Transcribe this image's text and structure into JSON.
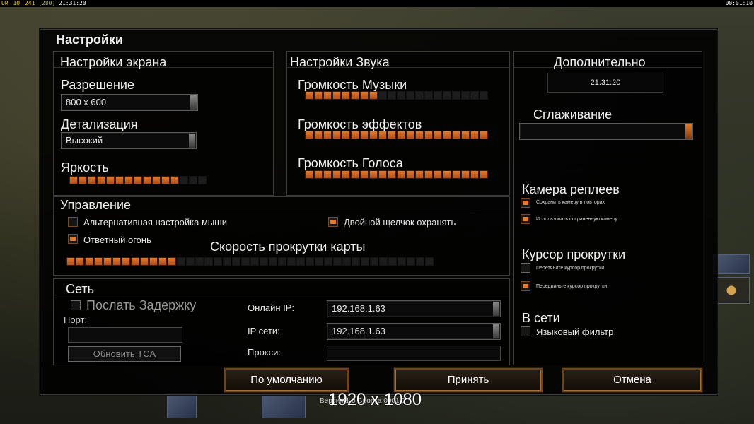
{
  "topbar": {
    "ur": "UR",
    "n1": "10",
    "n2": "241",
    "n3": "[280]",
    "time_left": "21:31:20",
    "time_right": "00:01:10"
  },
  "dialog": {
    "title": "Настройки"
  },
  "screen": {
    "header": "Настройки экрана",
    "resolution_label": "Разрешение",
    "resolution_value": "800 x 600",
    "detail_label": "Детализация",
    "detail_value": "Высокий",
    "brightness_label": "Яркость",
    "brightness_level": 12,
    "brightness_total": 15
  },
  "sound": {
    "header": "Настройки Звука",
    "music_label": "Громкость Музыки",
    "music_level": 8,
    "effects_label": "Громкость эффектов",
    "effects_level": 20,
    "voice_label": "Громкость Голоса",
    "voice_level": 20,
    "total": 20
  },
  "extra": {
    "header": "Дополнительно",
    "clock": "21:31:20",
    "antialias_label": "Сглаживание",
    "antialias_value": "",
    "replay_header": "Камера реплеев",
    "replay_opt1": "Сохранить камеру в повторах",
    "replay_opt1_checked": true,
    "replay_opt2": "Использовать сохраненную камеру",
    "replay_opt2_checked": true,
    "scroll_header": "Курсор прокрутки",
    "scroll_opt1": "Перетяните курсор прокрутки",
    "scroll_opt1_checked": false,
    "scroll_opt2": "Передвиньте курсор прокрутки",
    "scroll_opt2_checked": true,
    "online_header": "В сети",
    "lang_filter_label": "Языковый фильтр",
    "lang_filter_checked": false
  },
  "control": {
    "header": "Управление",
    "alt_mouse_label": "Альтернативная настройка мыши",
    "alt_mouse_checked": false,
    "double_click_label": "Двойной щелчок охранять",
    "double_click_checked": true,
    "return_fire_label": "Ответный огонь",
    "return_fire_checked": true,
    "scroll_speed_label": "Скорость прокрутки карты",
    "scroll_speed_level": 12,
    "scroll_speed_total": 40
  },
  "network": {
    "header": "Сеть",
    "send_delay_label": "Послать Задержку",
    "port_label": "Порт:",
    "port_value": "",
    "update_tca_label": "Обновить TCA",
    "online_ip_label": "Онлайн IP:",
    "online_ip_value": "192.168.1.63",
    "lan_ip_label": "IP сети:",
    "lan_ip_value": "192.168.1.63",
    "proxy_label": "Прокси:",
    "proxy_value": ""
  },
  "buttons": {
    "defaults": "По умолчанию",
    "accept": "Принять",
    "cancel": "Отмена"
  },
  "footer": {
    "resolution": "1920 x 1080",
    "version": "Версия 1.0 Сборка 0001.0"
  },
  "colors": {
    "accent_orange": "#e27a2a",
    "panel_border": "#3c3c3c",
    "bg": "#000000"
  }
}
